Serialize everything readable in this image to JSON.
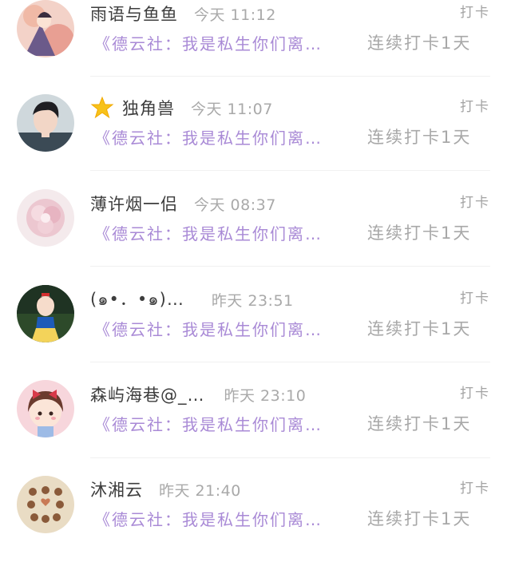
{
  "colors": {
    "background": "#ffffff",
    "name": "#3d3d3d",
    "time": "#a9a9a9",
    "group_link": "#a98ad6",
    "streak": "#a8a8a8",
    "tag": "#a3a3a3"
  },
  "items": [
    {
      "name": "雨语与鱼鱼",
      "time": "今天 11:12",
      "group": "《德云社：我是私生你们离…",
      "streak": "连续打卡1天",
      "tag": "打卡"
    },
    {
      "name": "独角兽",
      "time": "今天 11:07",
      "group": "《德云社：我是私生你们离…",
      "streak": "连续打卡1天",
      "tag": "打卡",
      "badge_icon": "star-icon"
    },
    {
      "name": "薄许烟一侣",
      "time": "今天 08:37",
      "group": "《德云社：我是私生你们离…",
      "streak": "连续打卡1天",
      "tag": "打卡"
    },
    {
      "name": "(๑•．•๑)…",
      "time": "昨天 23:51",
      "group": "《德云社：我是私生你们离…",
      "streak": "连续打卡1天",
      "tag": "打卡"
    },
    {
      "name": "森屿海巷@_…",
      "time": "昨天 23:10",
      "group": "《德云社：我是私生你们离…",
      "streak": "连续打卡1天",
      "tag": "打卡"
    },
    {
      "name": "沐湘云",
      "time": "昨天 21:40",
      "group": "《德云社：我是私生你们离…",
      "streak": "连续打卡1天",
      "tag": "打卡"
    }
  ]
}
